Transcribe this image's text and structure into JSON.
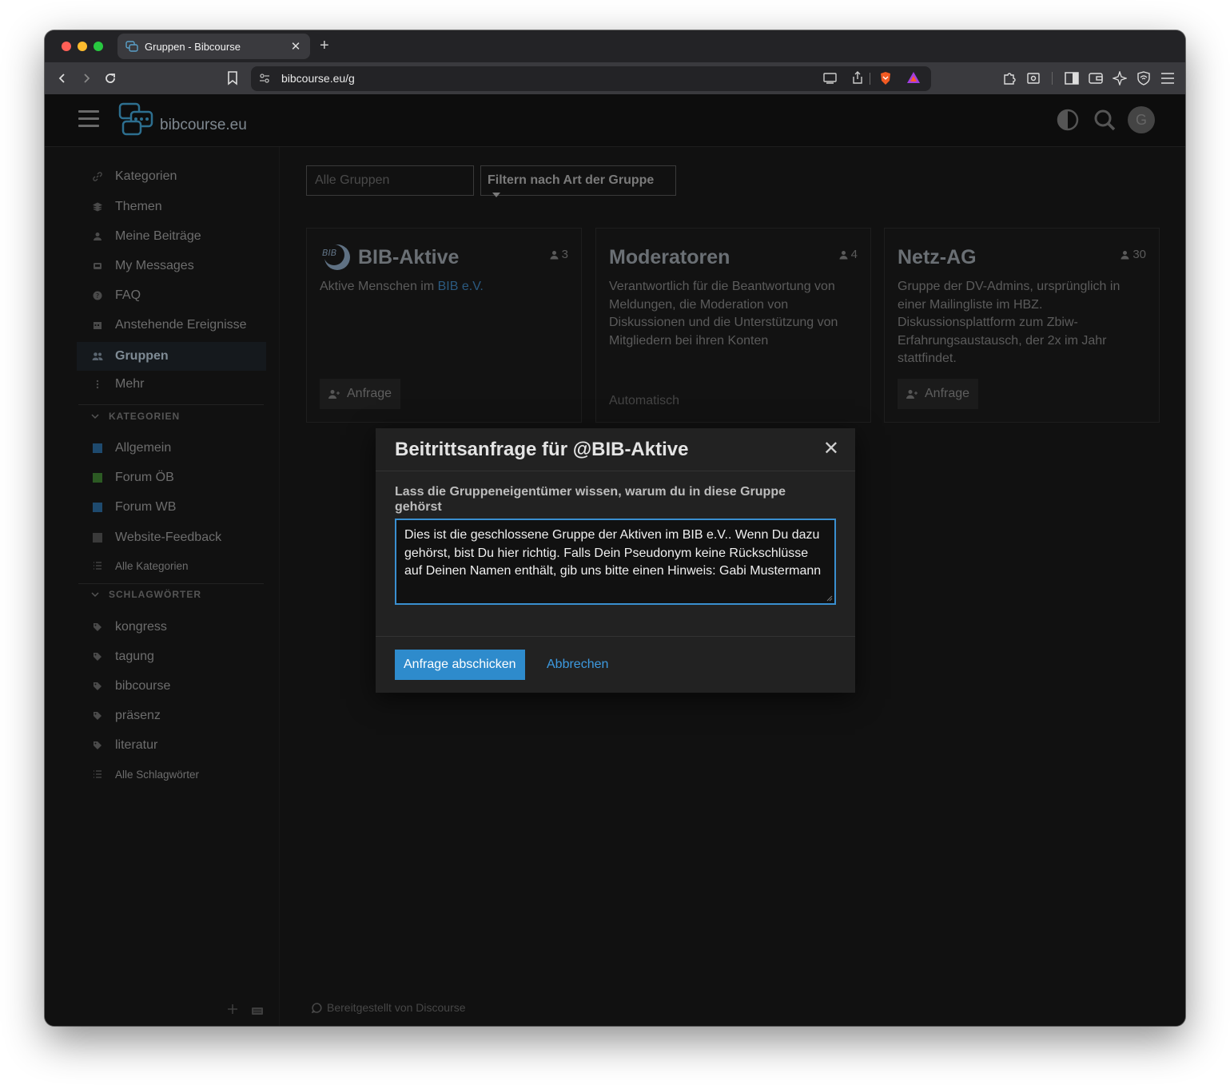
{
  "browser": {
    "tab_title": "Gruppen - Bibcourse",
    "tab_close": "✕",
    "new_tab": "+",
    "url": "bibcourse.eu/g"
  },
  "header": {
    "site_name": "bibcourse.eu",
    "avatar_letter": "G"
  },
  "sidebar": {
    "nav": [
      {
        "label": "Kategorien",
        "icon": "link-icon"
      },
      {
        "label": "Themen",
        "icon": "layers-icon"
      },
      {
        "label": "Meine Beiträge",
        "icon": "user-icon"
      },
      {
        "label": "My Messages",
        "icon": "inbox-icon"
      },
      {
        "label": "FAQ",
        "icon": "question-circle-icon"
      },
      {
        "label": "Anstehende Ereignisse",
        "icon": "calendar-icon"
      },
      {
        "label": "Gruppen",
        "icon": "users-icon",
        "active": true
      },
      {
        "label": "Mehr",
        "icon": "ellipsis-vertical-icon"
      }
    ],
    "categories_heading": "KATEGORIEN",
    "categories": [
      {
        "label": "Allgemein",
        "color": "#1e4a6e"
      },
      {
        "label": "Forum ÖB",
        "color": "#2c5a23"
      },
      {
        "label": "Forum WB",
        "color": "#1e4a6e"
      },
      {
        "label": "Website-Feedback",
        "color": "#3a3a3a"
      }
    ],
    "all_categories": "Alle Kategorien",
    "tags_heading": "SCHLAGWÖRTER",
    "tags": [
      "kongress",
      "tagung",
      "bibcourse",
      "präsenz",
      "literatur"
    ],
    "all_tags": "Alle Schlagwörter"
  },
  "filters": {
    "search_placeholder": "Alle Gruppen",
    "type_filter": "Filtern nach Art der Gruppe"
  },
  "groups": [
    {
      "title": "BIB-Aktive",
      "count": "3",
      "desc_prefix": "Aktive Menschen im ",
      "desc_link": "BIB e.V.",
      "action": "Anfrage"
    },
    {
      "title": "Moderatoren",
      "count": "4",
      "desc": "Verantwortlich für die Beantwortung von Meldungen, die Moderation von Diskussionen und die Unterstützung von Mitgliedern bei ihren Konten",
      "status": "Automatisch"
    },
    {
      "title": "Netz-AG",
      "count": "30",
      "desc": "Gruppe der DV-Admins, ursprünglich in einer Mailingliste im HBZ. Diskussionsplattform zum Zbiw-Erfahrungsaustausch, der 2x im Jahr stattfindet.",
      "action": "Anfrage"
    }
  ],
  "footer": {
    "powered_by": "Bereitgestellt von Discourse"
  },
  "modal": {
    "title": "Beitrittsanfrage für @BIB-Aktive",
    "close": "✕",
    "label": "Lass die Gruppeneigentümer wissen, warum du in diese Gruppe gehörst",
    "message": "Dies ist die geschlossene Gruppe der Aktiven im BIB e.V.. Wenn Du dazu gehörst, bist Du hier richtig. Falls Dein Pseudonym keine Rückschlüsse auf Deinen Namen enthält, gib uns bitte einen Hinweis: Gabi Mustermann",
    "submit": "Anfrage abschicken",
    "cancel": "Abbrechen"
  }
}
